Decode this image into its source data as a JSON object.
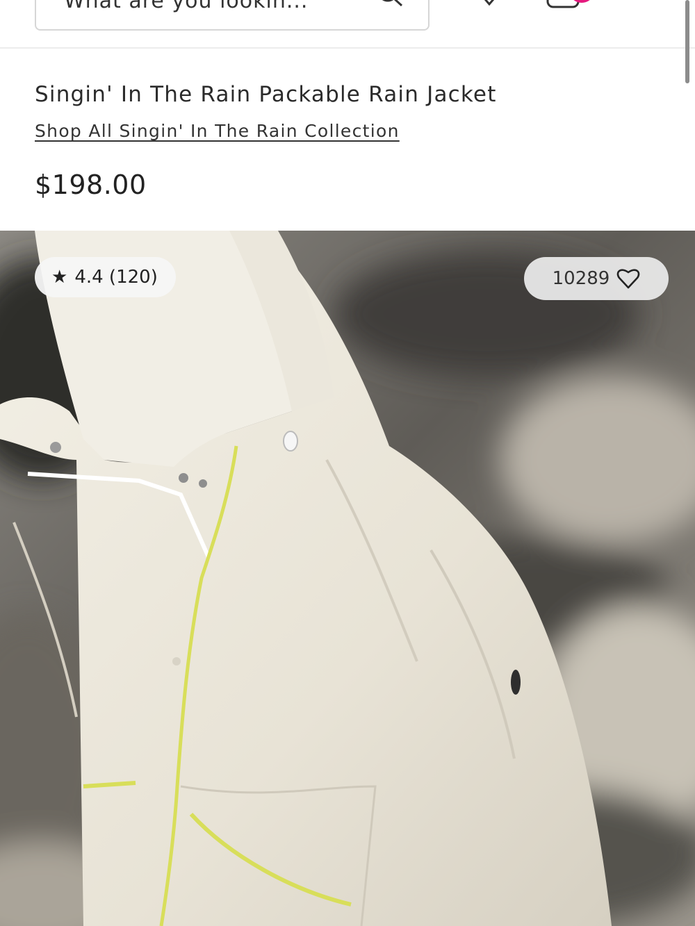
{
  "header": {
    "search_text": "What are you lookin...",
    "search_icon": "search-icon",
    "wishlist_icon": "heart-icon",
    "bag_icon": "shopping-bag-icon",
    "menu_icon": "hamburger-menu-icon",
    "badge_color": "#e5197e"
  },
  "product": {
    "title": "Singin' In The Rain Packable Rain Jacket",
    "collection_link": "Shop All Singin' In The Rain Collection",
    "price": "$198.00"
  },
  "gallery": {
    "rating_star": "★",
    "rating": "4.4 (120)",
    "wishlist_count": "10289",
    "wishlist_icon": "heart-outline-icon"
  },
  "colors": {
    "jacket": "#ece8dc",
    "zipper_trim": "#d8de5a",
    "background_rock": "#6f6c66"
  }
}
